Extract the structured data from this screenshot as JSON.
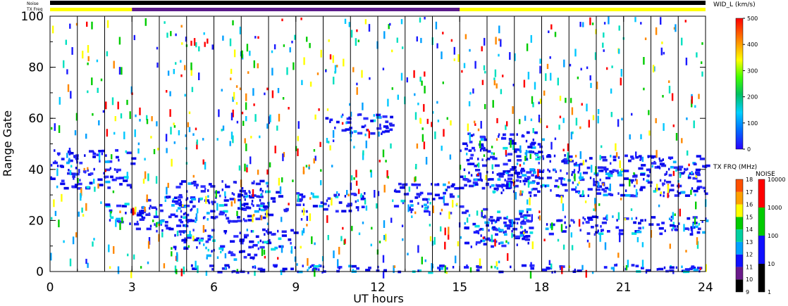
{
  "chart_data": {
    "type": "heatmap",
    "xlabel": "UT hours",
    "ylabel": "Range Gate",
    "xlim": [
      0,
      24
    ],
    "ylim": [
      0,
      100
    ],
    "x_ticks": [
      "0",
      "3",
      "6",
      "9",
      "12",
      "15",
      "18",
      "21",
      "24"
    ],
    "y_ticks": [
      "0",
      "20",
      "40",
      "60",
      "80",
      "100"
    ],
    "vertical_lines_hours": [
      0,
      1,
      2,
      3,
      4,
      5,
      6,
      7,
      8,
      9,
      10,
      11,
      12,
      13,
      14,
      15,
      16,
      17,
      18,
      19,
      20,
      21,
      22,
      23,
      24
    ],
    "status_bars": {
      "noise_label": "Noise",
      "txfreq_label": "TX Freq",
      "noise_color": "#000000",
      "txfreq_segments": [
        {
          "start": 0,
          "end": 3,
          "color": "#ffff00"
        },
        {
          "start": 3,
          "end": 15,
          "color": "#5a1a8a"
        },
        {
          "start": 15,
          "end": 24,
          "color": "#ffff00"
        }
      ]
    },
    "bands": [
      {
        "x0": 0,
        "x1": 3,
        "y0": 33,
        "y1": 48
      },
      {
        "x0": 2,
        "x1": 3.5,
        "y0": 19,
        "y1": 27
      },
      {
        "x0": 3,
        "x1": 5.2,
        "y0": 16,
        "y1": 30
      },
      {
        "x0": 4.5,
        "x1": 8,
        "y0": 20,
        "y1": 36
      },
      {
        "x0": 7,
        "x1": 11.5,
        "y0": 24,
        "y1": 32
      },
      {
        "x0": 4.5,
        "x1": 9,
        "y0": 9,
        "y1": 17
      },
      {
        "x0": 5.5,
        "x1": 7.5,
        "y0": 5,
        "y1": 9
      },
      {
        "x0": 10,
        "x1": 12.5,
        "y0": 54,
        "y1": 62
      },
      {
        "x0": 12.5,
        "x1": 15,
        "y0": 23,
        "y1": 35
      },
      {
        "x0": 15,
        "x1": 18,
        "y0": 33,
        "y1": 55
      },
      {
        "x0": 16,
        "x1": 24,
        "y0": 30,
        "y1": 40
      },
      {
        "x0": 18,
        "x1": 24,
        "y0": 38,
        "y1": 46
      },
      {
        "x0": 16,
        "x1": 24,
        "y0": 15,
        "y1": 22
      },
      {
        "x0": 15,
        "x1": 17.5,
        "y0": 10,
        "y1": 25
      },
      {
        "x0": 5,
        "x1": 24,
        "y0": 0,
        "y1": 3
      }
    ],
    "colorbars": [
      {
        "title": "WID_L (km/s)",
        "ticks": [
          "0",
          "100",
          "200",
          "300",
          "400",
          "500"
        ],
        "min": 0,
        "max": 500
      },
      {
        "title": "TX FRQ (MHz)",
        "ticks": [
          "9",
          "10",
          "11",
          "12",
          "13",
          "14",
          "15",
          "16",
          "17",
          "18"
        ],
        "min": 9,
        "max": 18
      },
      {
        "title": "NOISE",
        "ticks": [
          "1",
          "10",
          "100",
          "1000",
          "10000"
        ],
        "min": 1,
        "max": 10000,
        "scale": "log"
      }
    ]
  }
}
